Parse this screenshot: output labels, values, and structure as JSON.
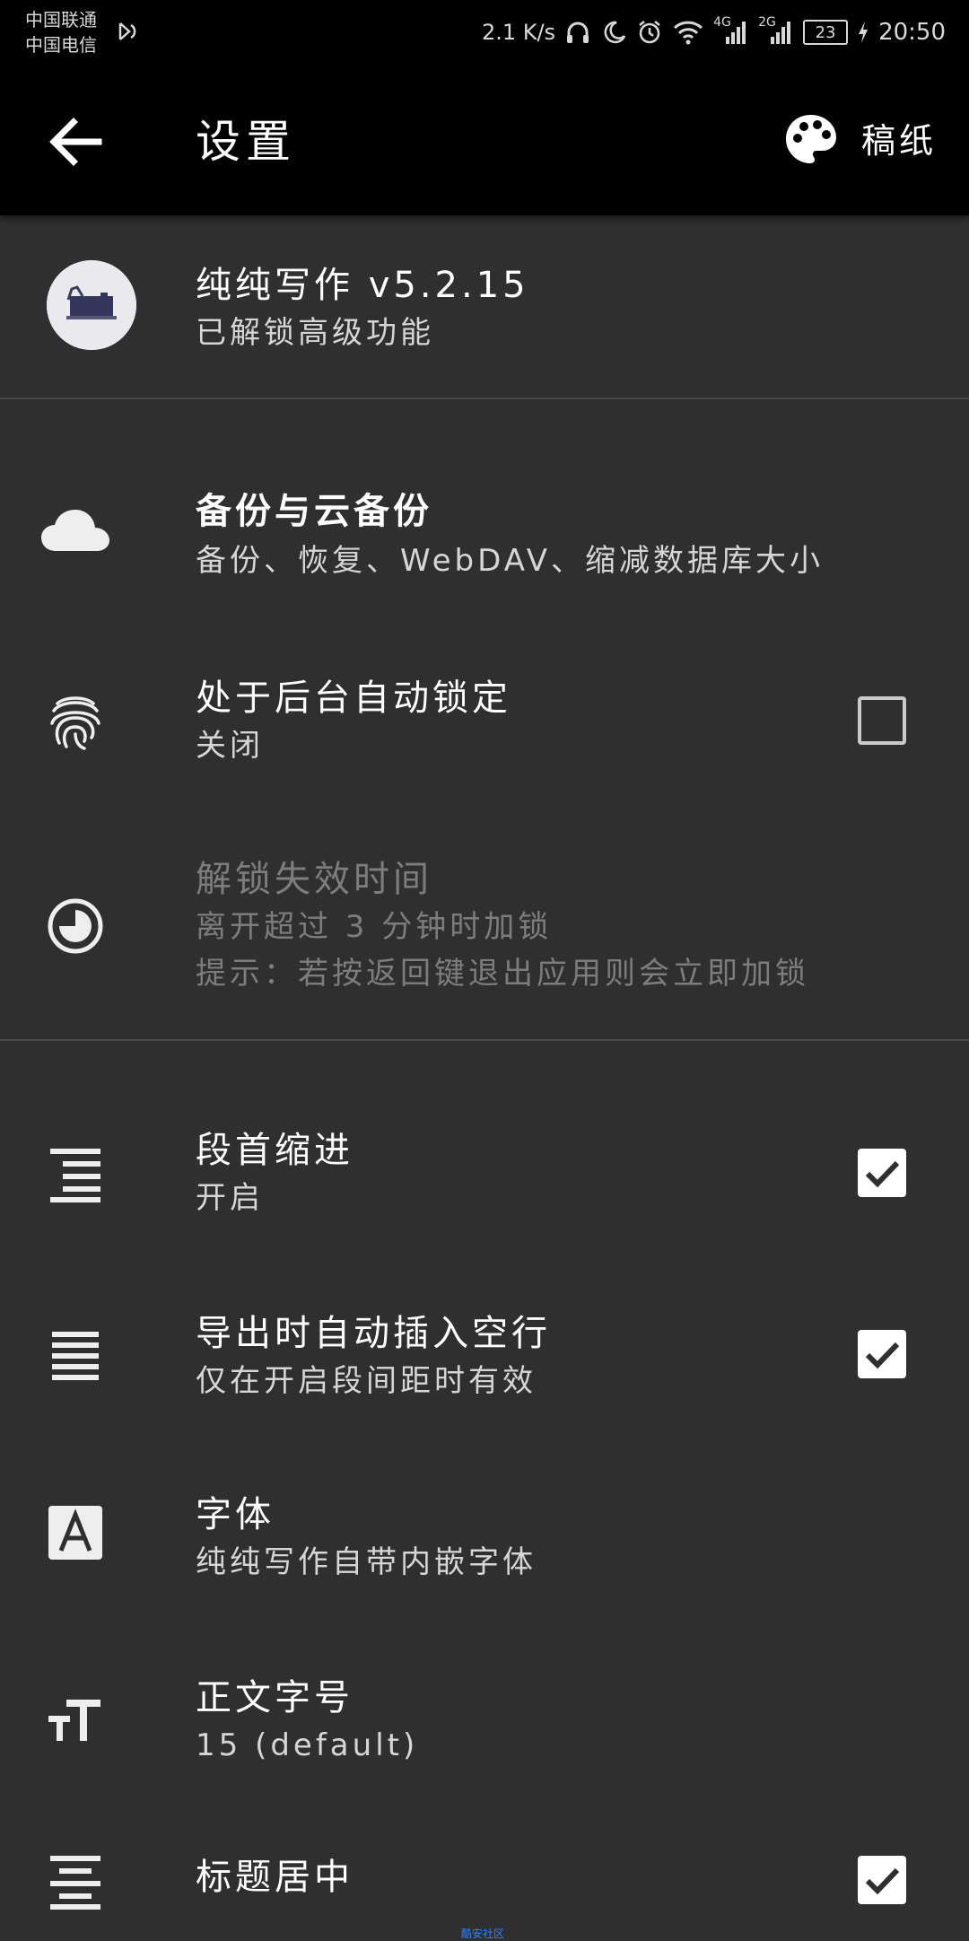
{
  "status_bar": {
    "carrier_line1": "中国联通",
    "carrier_line2": "中国电信",
    "speed": "2.1 K/s",
    "net1": "4G",
    "net2": "2G",
    "battery": "23",
    "time": "20:50"
  },
  "app_bar": {
    "title": "设置",
    "back_icon": "arrow-back-icon",
    "theme_icon": "palette-icon",
    "theme_label": "稿纸"
  },
  "about": {
    "title": "纯纯写作 v5.2.15",
    "subtitle": "已解锁高级功能"
  },
  "settings": {
    "backup": {
      "title": "备份与云备份",
      "subtitle": "备份、恢复、WebDAV、缩减数据库大小",
      "icon": "cloud-icon"
    },
    "auto_lock": {
      "title": "处于后台自动锁定",
      "subtitle": "关闭",
      "checked": false,
      "icon": "fingerprint-icon"
    },
    "unlock_timeout": {
      "title": "解锁失效时间",
      "subtitle": "离开超过 3 分钟时加锁",
      "hint": "提示：若按返回键退出应用则会立即加锁",
      "enabled": false,
      "icon": "timer-icon"
    },
    "indent": {
      "title": "段首缩进",
      "subtitle": "开启",
      "checked": true,
      "icon": "format-indent-icon"
    },
    "blank_line": {
      "title": "导出时自动插入空行",
      "subtitle": "仅在开启段间距时有效",
      "checked": true,
      "icon": "format-align-justify-icon"
    },
    "font": {
      "title": "字体",
      "subtitle": "纯纯写作自带内嵌字体",
      "icon": "font-a-icon"
    },
    "font_size": {
      "title": "正文字号",
      "subtitle": "15 (default)",
      "icon": "format-size-icon"
    },
    "center_title": {
      "title": "标题居中",
      "checked": true,
      "icon": "format-align-center-icon"
    }
  },
  "watermark": "酷安社区",
  "colors": {
    "background": "#2f2f30",
    "app_bar": "#000000",
    "divider": "#4a4a4b",
    "disabled_text": "#7d7d7d"
  }
}
